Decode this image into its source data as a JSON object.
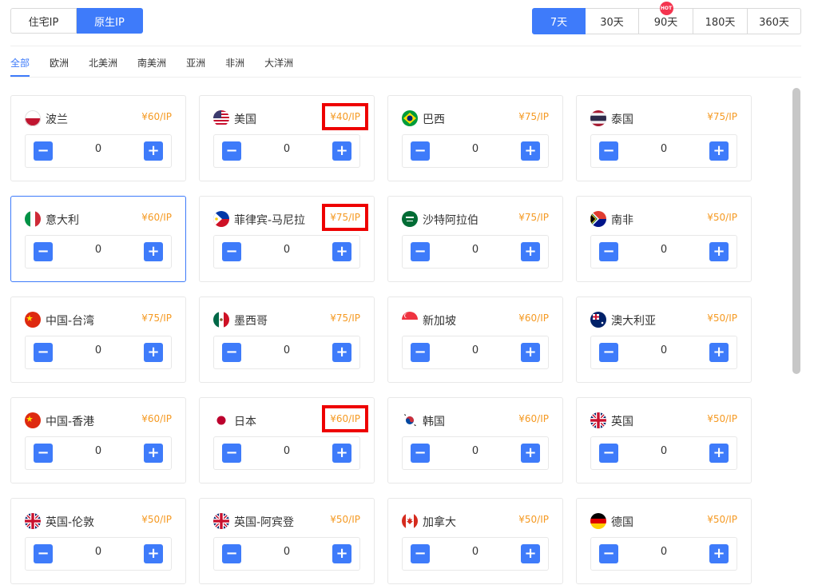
{
  "ip_types": [
    {
      "label": "住宅IP",
      "active": false
    },
    {
      "label": "原生IP",
      "active": true
    }
  ],
  "periods": [
    {
      "label": "7天",
      "active": true
    },
    {
      "label": "30天",
      "active": false
    },
    {
      "label": "90天",
      "active": false,
      "badge": "HOT"
    },
    {
      "label": "180天",
      "active": false
    },
    {
      "label": "360天",
      "active": false
    }
  ],
  "regions": [
    "全部",
    "欧洲",
    "北美洲",
    "南美洲",
    "亚洲",
    "非洲",
    "大洋洲"
  ],
  "active_region": "全部",
  "accent_color": "#3e7bfa",
  "price_color": "#f59a23",
  "highlight_color": "#ee0000",
  "countries": [
    {
      "name": "波兰",
      "price": "¥60/IP",
      "qty": "0",
      "flag": "poland-flag-icon"
    },
    {
      "name": "美国",
      "price": "¥40/IP",
      "qty": "0",
      "flag": "usa-flag-icon",
      "highlighted": true
    },
    {
      "name": "巴西",
      "price": "¥75/IP",
      "qty": "0",
      "flag": "brazil-flag-icon"
    },
    {
      "name": "泰国",
      "price": "¥75/IP",
      "qty": "0",
      "flag": "thailand-flag-icon"
    },
    {
      "name": "意大利",
      "price": "¥60/IP",
      "qty": "0",
      "flag": "italy-flag-icon",
      "selected": true
    },
    {
      "name": "菲律宾-马尼拉",
      "price": "¥75/IP",
      "qty": "0",
      "flag": "philippines-flag-icon",
      "highlighted": true
    },
    {
      "name": "沙特阿拉伯",
      "price": "¥75/IP",
      "qty": "0",
      "flag": "saudi-arabia-flag-icon"
    },
    {
      "name": "南非",
      "price": "¥50/IP",
      "qty": "0",
      "flag": "south-africa-flag-icon"
    },
    {
      "name": "中国-台湾",
      "price": "¥75/IP",
      "qty": "0",
      "flag": "china-flag-icon"
    },
    {
      "name": "墨西哥",
      "price": "¥75/IP",
      "qty": "0",
      "flag": "mexico-flag-icon"
    },
    {
      "name": "新加坡",
      "price": "¥60/IP",
      "qty": "0",
      "flag": "singapore-flag-icon"
    },
    {
      "name": "澳大利亚",
      "price": "¥50/IP",
      "qty": "0",
      "flag": "australia-flag-icon"
    },
    {
      "name": "中国-香港",
      "price": "¥60/IP",
      "qty": "0",
      "flag": "china-flag-icon"
    },
    {
      "name": "日本",
      "price": "¥60/IP",
      "qty": "0",
      "flag": "japan-flag-icon",
      "highlighted": true
    },
    {
      "name": "韩国",
      "price": "¥60/IP",
      "qty": "0",
      "flag": "korea-flag-icon"
    },
    {
      "name": "英国",
      "price": "¥50/IP",
      "qty": "0",
      "flag": "uk-flag-icon"
    },
    {
      "name": "英国-伦敦",
      "price": "¥50/IP",
      "qty": "0",
      "flag": "uk-flag-icon"
    },
    {
      "name": "英国-阿宾登",
      "price": "¥50/IP",
      "qty": "0",
      "flag": "uk-flag-icon"
    },
    {
      "name": "加拿大",
      "price": "¥50/IP",
      "qty": "0",
      "flag": "canada-flag-icon"
    },
    {
      "name": "德国",
      "price": "¥50/IP",
      "qty": "0",
      "flag": "germany-flag-icon"
    }
  ],
  "stepper": {
    "minus": "−",
    "plus": "+"
  }
}
